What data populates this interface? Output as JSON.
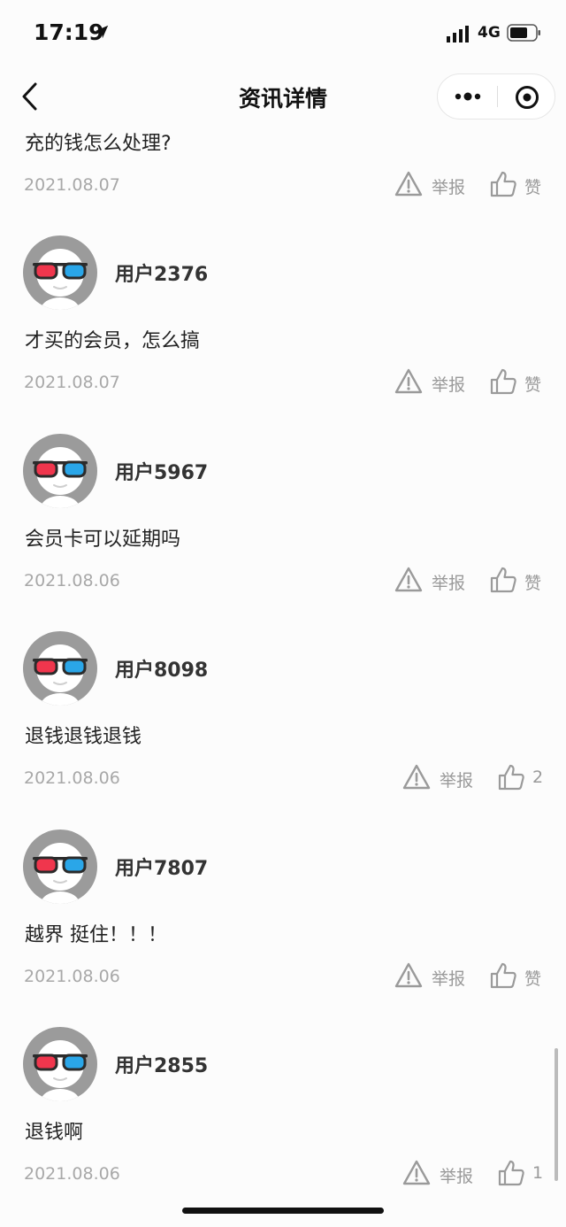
{
  "status_bar": {
    "time": "17:19",
    "network": "4G"
  },
  "nav": {
    "title": "资讯详情"
  },
  "actions": {
    "report_label": "举报"
  },
  "comments": [
    {
      "user": "",
      "text": "充的钱怎么处理?",
      "date": "2021.08.07",
      "likes": "赞"
    },
    {
      "user": "用户2376",
      "text": "才买的会员，怎么搞",
      "date": "2021.08.07",
      "likes": "赞"
    },
    {
      "user": "用户5967",
      "text": "会员卡可以延期吗",
      "date": "2021.08.06",
      "likes": "赞"
    },
    {
      "user": "用户8098",
      "text": "退钱退钱退钱",
      "date": "2021.08.06",
      "likes": "2"
    },
    {
      "user": "用户7807",
      "text": "越界 挺住！！！",
      "date": "2021.08.06",
      "likes": "赞"
    },
    {
      "user": "用户2855",
      "text": "退钱啊",
      "date": "2021.08.06",
      "likes": "1"
    }
  ],
  "colors": {
    "lens_left": "#f0364d",
    "lens_right": "#2aa6e8",
    "avatar_bg": "#9b9b9b"
  }
}
